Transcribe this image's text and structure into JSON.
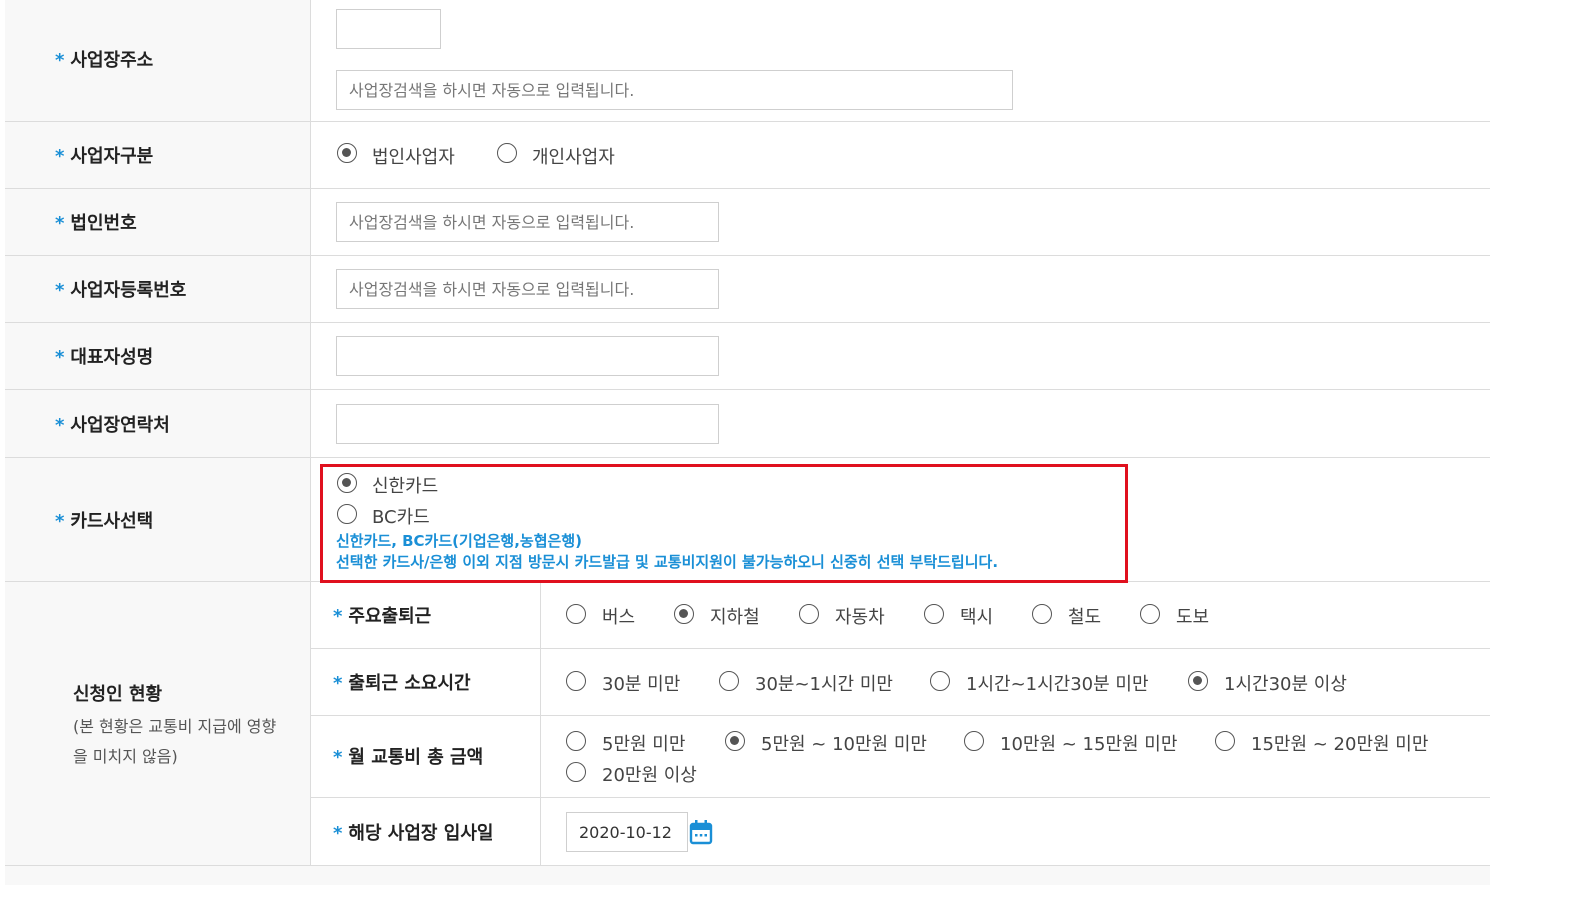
{
  "rows": {
    "address": {
      "label": "사업장주소",
      "postcode_value": "",
      "address_placeholder": "사업장검색을 하시면 자동으로 입력됩니다."
    },
    "business_type": {
      "label": "사업자구분",
      "options": [
        "법인사업자",
        "개인사업자"
      ],
      "selected": "법인사업자"
    },
    "corp_number": {
      "label": "법인번호",
      "placeholder": "사업장검색을 하시면 자동으로 입력됩니다."
    },
    "biz_reg_number": {
      "label": "사업자등록번호",
      "placeholder": "사업장검색을 하시면 자동으로 입력됩니다."
    },
    "rep_name": {
      "label": "대표자성명",
      "value": ""
    },
    "contact": {
      "label": "사업장연락처",
      "value": ""
    },
    "card": {
      "label": "카드사선택",
      "options": [
        "신한카드",
        "BC카드"
      ],
      "selected": "신한카드",
      "notice_line1": "신한카드,  BC카드(기업은행,농협은행)",
      "notice_line2": "선택한 카드사/은행 이외 지점 방문시 카드발급 및 교통비지원이 불가능하오니 신중히 선택 부탁드립니다."
    }
  },
  "applicant": {
    "title": "신청인 현황",
    "note": "(본 현황은 교통비 지급에 영향을 미치지 않음)",
    "commute": {
      "label": "주요출퇴근",
      "options": [
        "버스",
        "지하철",
        "자동차",
        "택시",
        "철도",
        "도보"
      ],
      "selected": "지하철"
    },
    "duration": {
      "label": "출퇴근 소요시간",
      "options": [
        "30분 미만",
        "30분~1시간 미만",
        "1시간~1시간30분 미만",
        "1시간30분 이상"
      ],
      "selected": "1시간30분 이상"
    },
    "cost": {
      "label": "월 교통비 총 금액",
      "options": [
        "5만원 미만",
        "5만원 ~ 10만원 미만",
        "10만원 ~ 15만원 미만",
        "15만원 ~ 20만원 미만",
        "20만원 이상"
      ],
      "selected": "5만원 ~ 10만원 미만"
    },
    "join_date": {
      "label": "해당 사업장 입사일",
      "value": "2020-10-12"
    }
  },
  "required_mark": "*",
  "colors": {
    "accent": "#1a8fd6",
    "highlight_border": "#e0101e"
  },
  "icons": {
    "calendar": "calendar-icon"
  }
}
